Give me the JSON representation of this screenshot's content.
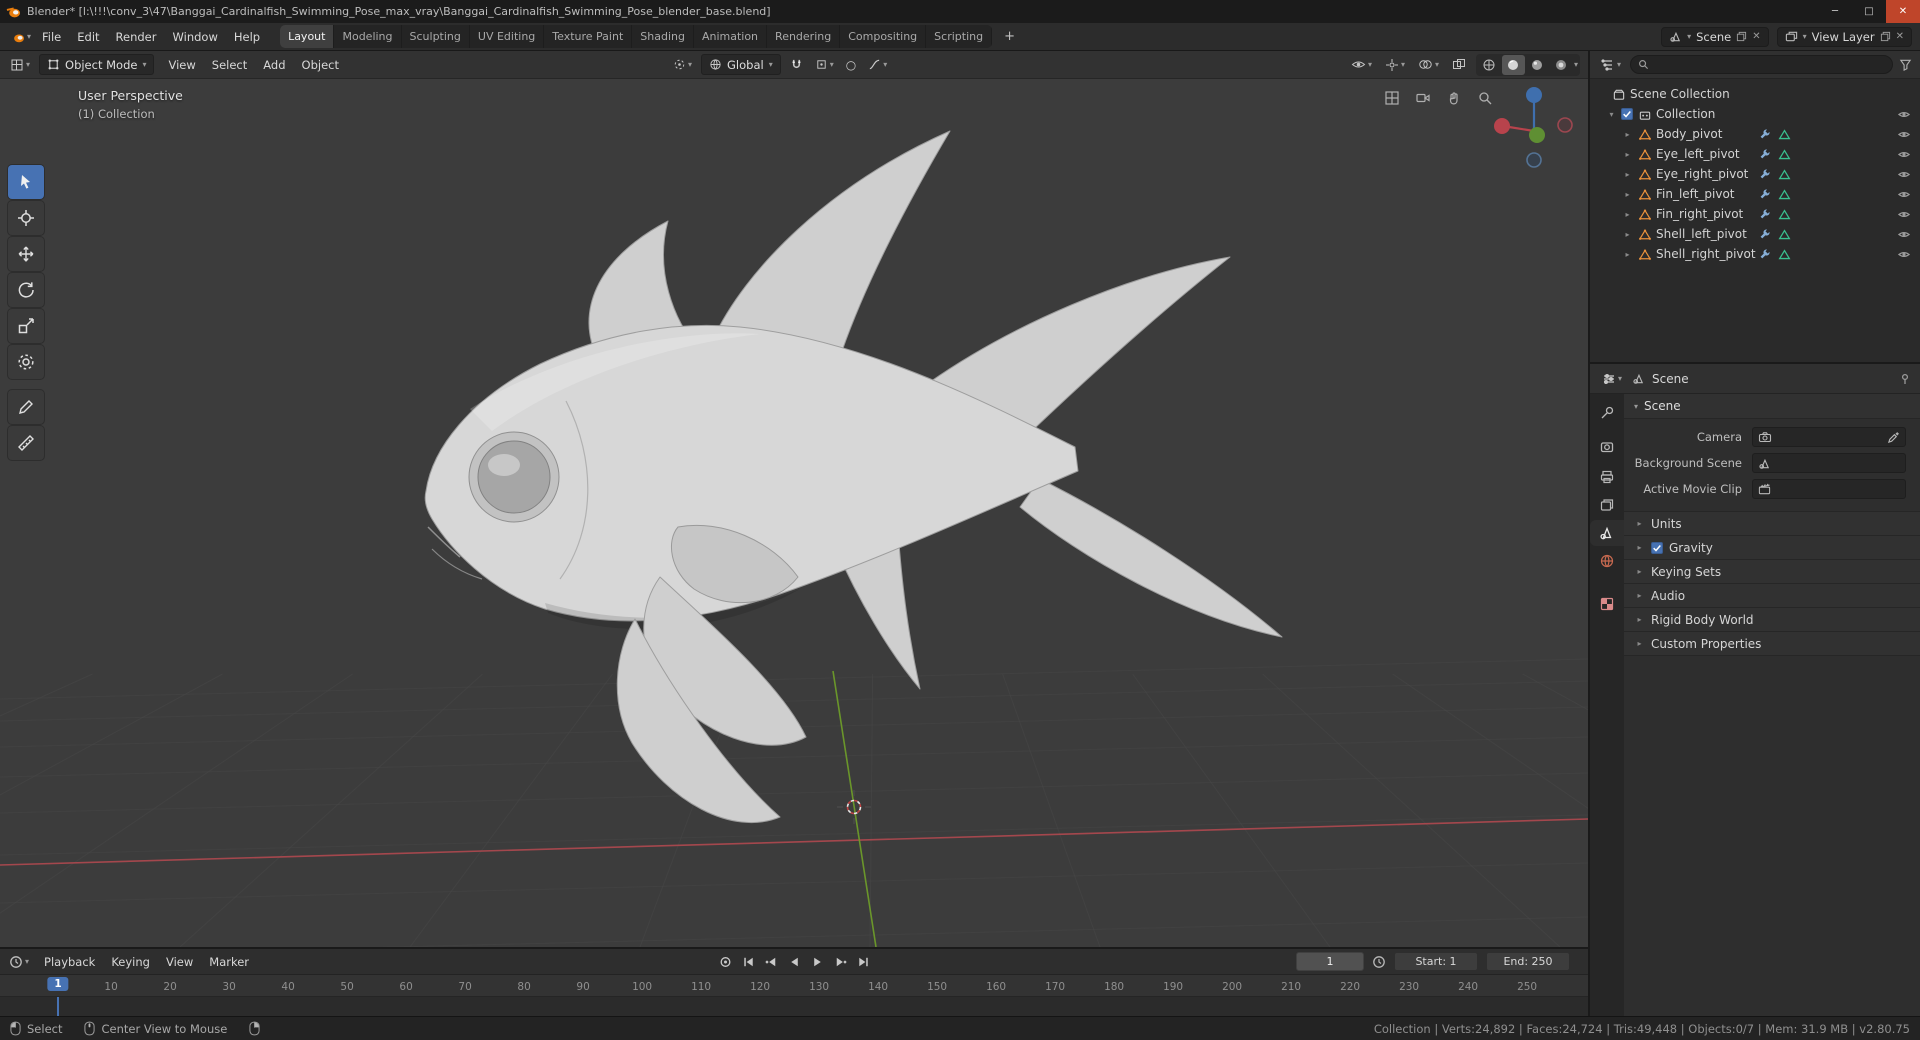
{
  "window": {
    "title": "Blender* [l:\\!!!\\conv_3\\47\\Banggai_Cardinalfish_Swimming_Pose_max_vray\\Banggai_Cardinalfish_Swimming_Pose_blender_base.blend]",
    "controls": {
      "minimize": "─",
      "maximize": "□",
      "close": "✕"
    }
  },
  "icons": {
    "caret_down": "▾",
    "disclosure": "▸",
    "disclosure_open": "▾",
    "proportional_circle": "○",
    "close": "✕",
    "add": "+"
  },
  "colors": {
    "accent": "#4772b3",
    "brand_orange": "#e87d0d",
    "axis_x": "#b0494f",
    "axis_y": "#6d9b2a",
    "mesh_icon": "#e8913c",
    "data_icon": "#39c08e"
  },
  "topbar": {
    "menus": [
      {
        "label": "File"
      },
      {
        "label": "Edit"
      },
      {
        "label": "Render"
      },
      {
        "label": "Window"
      },
      {
        "label": "Help"
      }
    ],
    "workspaces": [
      {
        "label": "Layout",
        "active": true
      },
      {
        "label": "Modeling"
      },
      {
        "label": "Sculpting"
      },
      {
        "label": "UV Editing"
      },
      {
        "label": "Texture Paint"
      },
      {
        "label": "Shading"
      },
      {
        "label": "Animation"
      },
      {
        "label": "Rendering"
      },
      {
        "label": "Compositing"
      },
      {
        "label": "Scripting"
      }
    ],
    "add_workspace": "+",
    "scene": {
      "value": "Scene"
    },
    "view_layer": {
      "value": "View Layer"
    }
  },
  "viewport": {
    "header": {
      "mode": "Object Mode",
      "menus": [
        {
          "label": "View"
        },
        {
          "label": "Select"
        },
        {
          "label": "Add"
        },
        {
          "label": "Object"
        }
      ],
      "orientation": "Global"
    },
    "overlay_line1": "User Perspective",
    "overlay_line2": "(1) Collection"
  },
  "outliner": {
    "search_placeholder": "",
    "root_label": "Scene Collection",
    "collection": {
      "label": "Collection",
      "checked": true
    },
    "items": [
      {
        "label": "Body_pivot"
      },
      {
        "label": "Eye_left_pivot"
      },
      {
        "label": "Eye_right_pivot"
      },
      {
        "label": "Fin_left_pivot"
      },
      {
        "label": "Fin_right_pivot"
      },
      {
        "label": "Shell_left_pivot"
      },
      {
        "label": "Shell_right_pivot"
      }
    ]
  },
  "properties": {
    "breadcrumb": "Scene",
    "scene_panel": {
      "title": "Scene",
      "fields": [
        {
          "label": "Camera"
        },
        {
          "label": "Background Scene"
        },
        {
          "label": "Active Movie Clip"
        }
      ]
    },
    "collapsed_panels": [
      {
        "label": "Units"
      },
      {
        "label": "Gravity",
        "checkbox": true,
        "checked": true
      },
      {
        "label": "Keying Sets"
      },
      {
        "label": "Audio"
      },
      {
        "label": "Rigid Body World"
      },
      {
        "label": "Custom Properties"
      }
    ]
  },
  "timeline": {
    "menus": [
      {
        "label": "Playback"
      },
      {
        "label": "Keying"
      },
      {
        "label": "View"
      },
      {
        "label": "Marker"
      }
    ],
    "current_frame": "1",
    "frame_field": "1",
    "start_field": "Start: 1",
    "end_field": "End: 250",
    "ticks": [
      "10",
      "20",
      "30",
      "40",
      "50",
      "60",
      "70",
      "80",
      "90",
      "100",
      "110",
      "120",
      "130",
      "140",
      "150",
      "160",
      "170",
      "180",
      "190",
      "200",
      "210",
      "220",
      "230",
      "240",
      "250"
    ]
  },
  "statusbar": {
    "items": [
      {
        "icon": "mouse-left",
        "label": "Select"
      },
      {
        "icon": "mouse-middle",
        "label": "Center View to Mouse"
      },
      {
        "icon": "mouse-right",
        "label": ""
      }
    ],
    "stats": "Collection | Verts:24,892 | Faces:24,724 | Tris:49,448 | Objects:0/7 | Mem: 31.9 MB | v2.80.75"
  }
}
